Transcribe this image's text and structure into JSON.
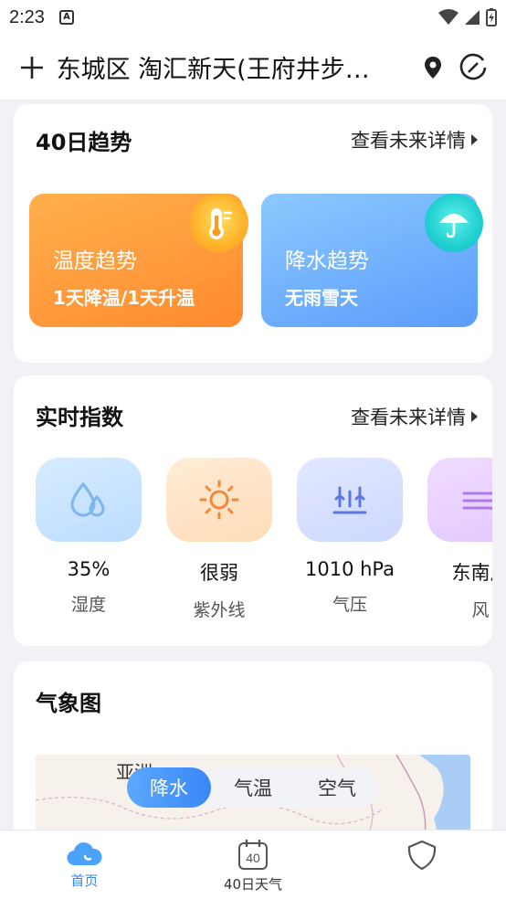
{
  "status_bar": {
    "time": "2:23",
    "notif_letter": "A"
  },
  "header": {
    "location": "东城区 淘汇新天(王府井步…"
  },
  "trend_card": {
    "title": "40日趋势",
    "more": "查看未来详情",
    "temp_tile": {
      "label": "温度趋势",
      "value": "1天降温/1天升温"
    },
    "rain_tile": {
      "label": "降水趋势",
      "value": "无雨雪天"
    }
  },
  "index_card": {
    "title": "实时指数",
    "more": "查看未来详情",
    "items": [
      {
        "value": "35%",
        "label": "湿度",
        "icon": "humidity-icon"
      },
      {
        "value": "很弱",
        "label": "紫外线",
        "icon": "sun-icon"
      },
      {
        "value": "1010 hPa",
        "label": "气压",
        "icon": "pressure-icon"
      },
      {
        "value": "东南风",
        "label": "风",
        "icon": "wind-icon"
      }
    ]
  },
  "map_card": {
    "title": "气象图",
    "map_text": "亚洲",
    "tabs": [
      {
        "label": "降水",
        "active": true
      },
      {
        "label": "气温",
        "active": false
      },
      {
        "label": "空气",
        "active": false
      }
    ]
  },
  "bottom_nav": {
    "home": "首页",
    "forty_day": "40日天气",
    "forty_badge": "40"
  },
  "colors": {
    "accent": "#3a86f6",
    "temp_tile": "#ff8a2e",
    "rain_tile": "#5a9cfb"
  }
}
